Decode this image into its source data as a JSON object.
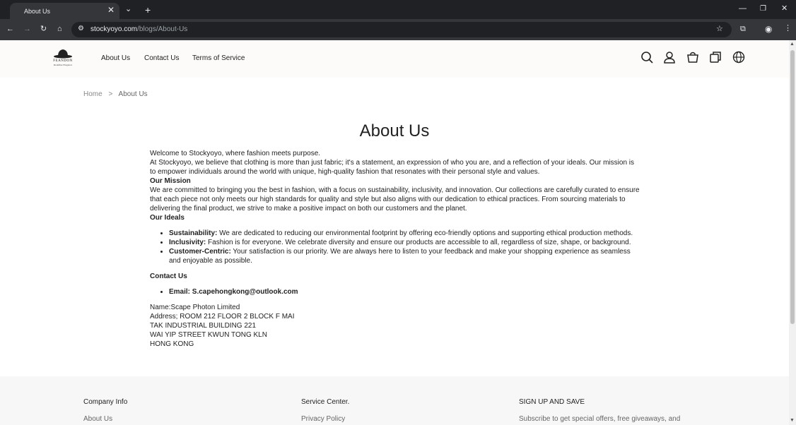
{
  "browser": {
    "tab_title": "About Us",
    "url_host": "stockyoyo.com",
    "url_path": "/blogs/About-Us"
  },
  "header": {
    "logo_text": "FEANDON",
    "logo_sub": "Redefine Elegance",
    "nav": [
      "About Us",
      "Contact Us",
      "Terms of Service"
    ],
    "icons": [
      "search-icon",
      "account-icon",
      "cart-icon",
      "orders-icon",
      "globe-icon"
    ]
  },
  "breadcrumb": {
    "home": "Home",
    "sep": ">",
    "current": "About Us"
  },
  "page_title": "About Us",
  "content": {
    "welcome": "Welcome to Stockyoyo, where fashion meets purpose.",
    "intro": "At Stockyoyo, we believe that clothing is more than just fabric; it's a statement, an expression of who you are, and a reflection of your ideals. Our mission is to empower individuals around the world with unique, high-quality fashion that resonates with their personal style and values.",
    "mission_head": "Our Mission",
    "mission": "We are committed to bringing you the best in fashion, with a focus on sustainability, inclusivity, and innovation. Our collections are carefully curated to ensure that each piece not only meets our high standards for quality and style but also aligns with our dedication to ethical practices. From sourcing materials to delivering the final product, we strive to make a positive impact on both our customers and the planet.",
    "ideals_head": "Our Ideals",
    "ideals": [
      {
        "label": "Sustainability:",
        "text": " We are dedicated to reducing our environmental footprint by offering eco-friendly options and supporting ethical production methods."
      },
      {
        "label": "Inclusivity:",
        "text": " Fashion is for everyone. We celebrate diversity and ensure our products are accessible to all, regardless of size, shape, or background."
      },
      {
        "label": "Customer-Centric:",
        "text": " Your satisfaction is our priority. We are always here to listen to your feedback and make your shopping experience as seamless and enjoyable as possible."
      }
    ],
    "contact_head": "Contact Us",
    "email": "Email: S.capehongkong@outlook.com",
    "address_lines": [
      "Name:Scape Photon Limited",
      "Address; ROOM 212 FLOOR 2 BLOCK F MAI",
      "TAK INDUSTRIAL BUILDING 221",
      "WAI YIP STREET KWUN TONG KLN",
      "HONG KONG"
    ]
  },
  "footer": {
    "company_head": "Company Info",
    "company_link": "About Us",
    "service_head": "Service Center.",
    "service_link": "Privacy Policy",
    "signup_head": "SIGN UP AND SAVE",
    "signup_text": "Subscribe to get special offers, free giveaways, and"
  }
}
